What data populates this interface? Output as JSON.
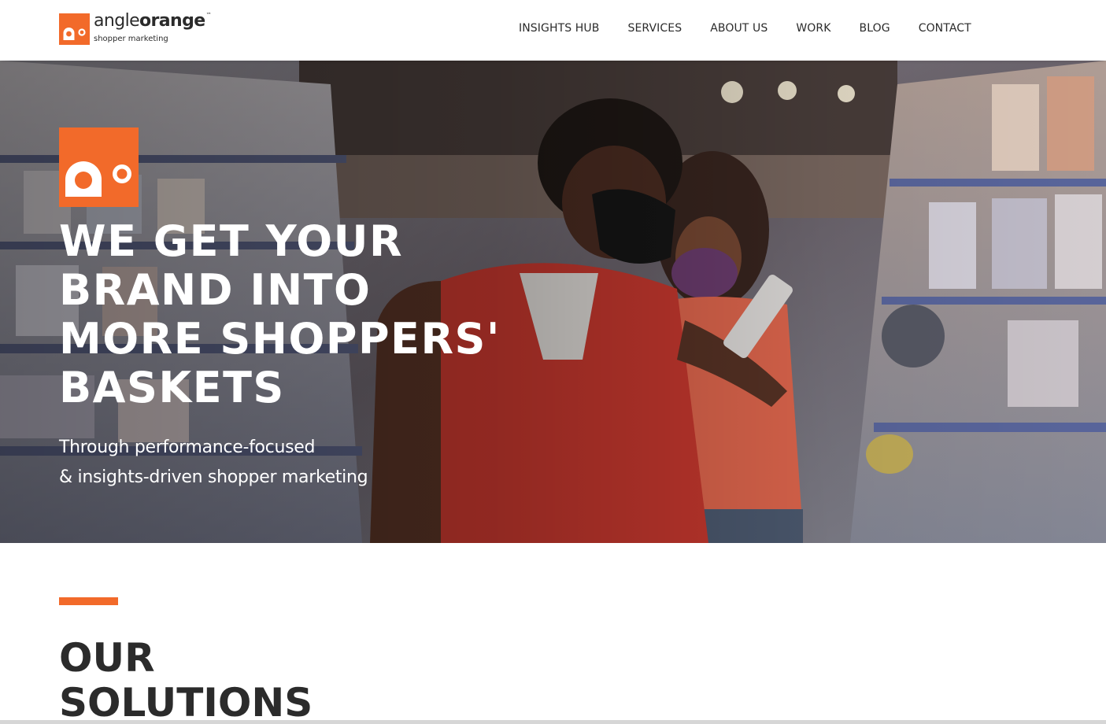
{
  "brand": {
    "name_light": "angle",
    "name_bold": "orange",
    "trademark": "™",
    "tagline": "shopper marketing",
    "accent_color": "#f26a2a",
    "logo_icon": "angleorange-logo-icon"
  },
  "nav": {
    "items": [
      {
        "label": "INSIGHTS HUB"
      },
      {
        "label": "SERVICES"
      },
      {
        "label": "ABOUT US"
      },
      {
        "label": "WORK"
      },
      {
        "label": "BLOG"
      },
      {
        "label": "CONTACT"
      }
    ]
  },
  "hero": {
    "title_lines": [
      "WE GET YOUR",
      "BRAND INTO",
      "MORE SHOPPERS'",
      "BASKETS"
    ],
    "subtitle_lines": [
      "Through performance-focused",
      "& insights-driven shopper marketing"
    ],
    "image": "couple-shopping-in-supermarket-aisle-photo"
  },
  "solutions": {
    "title_lines": [
      "OUR",
      "SOLUTIONS"
    ]
  }
}
